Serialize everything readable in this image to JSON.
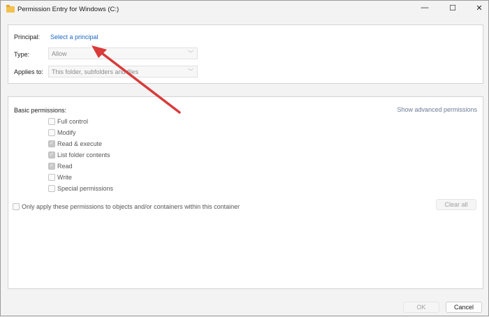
{
  "window": {
    "title": "Permission Entry for Windows (C:)",
    "minimize": "—",
    "maximize": "☐",
    "close": "✕"
  },
  "principal": {
    "label": "Principal:",
    "link": "Select a principal"
  },
  "type": {
    "label": "Type:",
    "value": "Allow"
  },
  "applies_to": {
    "label": "Applies to:",
    "value": "This folder, subfolders and files"
  },
  "basic": {
    "label": "Basic permissions:",
    "advanced_link": "Show advanced permissions",
    "items": [
      {
        "label": "Full control",
        "checked": false
      },
      {
        "label": "Modify",
        "checked": false
      },
      {
        "label": "Read & execute",
        "checked": true
      },
      {
        "label": "List folder contents",
        "checked": true
      },
      {
        "label": "Read",
        "checked": true
      },
      {
        "label": "Write",
        "checked": false
      },
      {
        "label": "Special permissions",
        "checked": false
      }
    ]
  },
  "only_apply": {
    "label": "Only apply these permissions to objects and/or containers within this container",
    "checked": false
  },
  "buttons": {
    "clear_all": "Clear all",
    "ok": "OK",
    "cancel": "Cancel"
  },
  "annotation_color": "#d93a3a"
}
